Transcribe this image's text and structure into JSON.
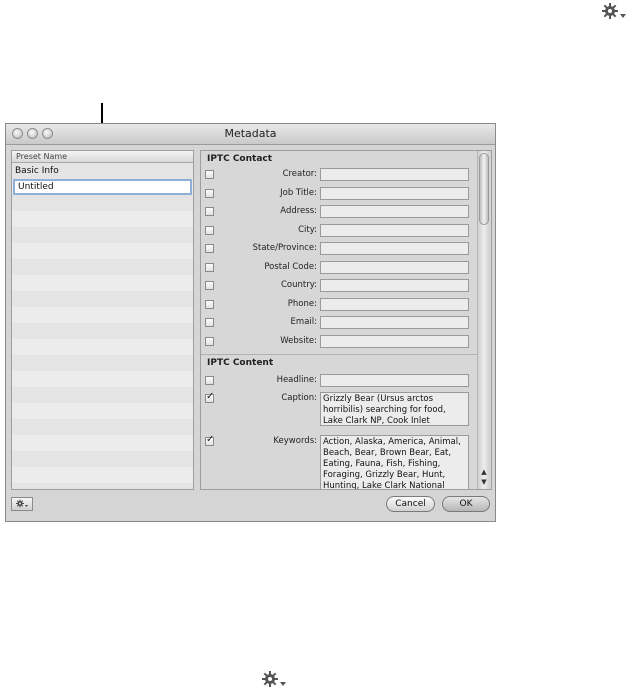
{
  "window": {
    "title": "Metadata"
  },
  "presets": {
    "header": "Preset Name",
    "items": [
      {
        "label": "Basic Info"
      },
      {
        "label": "Untitled",
        "editing": true
      }
    ]
  },
  "sections": [
    {
      "title": "IPTC Contact",
      "fields": [
        {
          "label": "Creator:",
          "value": "",
          "checked": false
        },
        {
          "label": "Job Title:",
          "value": "",
          "checked": false
        },
        {
          "label": "Address:",
          "value": "",
          "checked": false
        },
        {
          "label": "City:",
          "value": "",
          "checked": false
        },
        {
          "label": "State/Province:",
          "value": "",
          "checked": false
        },
        {
          "label": "Postal Code:",
          "value": "",
          "checked": false
        },
        {
          "label": "Country:",
          "value": "",
          "checked": false
        },
        {
          "label": "Phone:",
          "value": "",
          "checked": false
        },
        {
          "label": "Email:",
          "value": "",
          "checked": false
        },
        {
          "label": "Website:",
          "value": "",
          "checked": false
        }
      ]
    },
    {
      "title": "IPTC Content",
      "fields": [
        {
          "label": "Headline:",
          "value": "",
          "checked": false
        },
        {
          "label": "Caption:",
          "value": "Grizzly Bear (Ursus arctos horribilis) searching for food, Lake Clark NP, Cook Inlet",
          "checked": true
        },
        {
          "label": "Keywords:",
          "value": "Action, Alaska, America, Animal, Beach, Bear, Brown Bear, Eat, Eating, Fauna, Fish, Fishing, Foraging, Grizzly Bear, Hunt, Hunting, Lake Clark National",
          "checked": true
        }
      ]
    }
  ],
  "buttons": {
    "cancel": "Cancel",
    "ok": "OK"
  },
  "icons": {
    "action_menu": "gear-icon"
  }
}
